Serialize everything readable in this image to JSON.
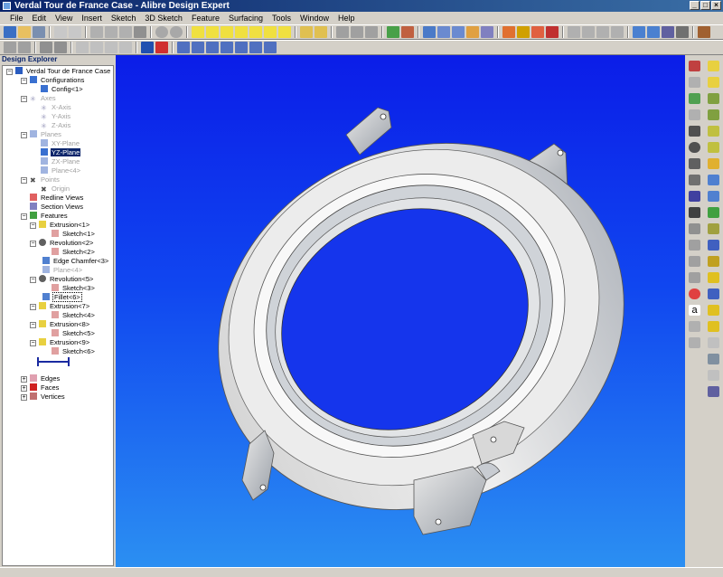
{
  "window": {
    "title": "Verdal Tour de France Case - Alibre Design Expert"
  },
  "menu": [
    "File",
    "Edit",
    "View",
    "Insert",
    "Sketch",
    "3D Sketch",
    "Feature",
    "Surfacing",
    "Tools",
    "Window",
    "Help"
  ],
  "explorer": {
    "title": "Design Explorer",
    "root": "Verdal Tour de France Case",
    "configurations": {
      "label": "Configurations",
      "child": "Config<1>"
    },
    "axes": {
      "label": "Axes",
      "children": [
        "X-Axis",
        "Y-Axis",
        "Z-Axis"
      ]
    },
    "planes": {
      "label": "Planes",
      "children": [
        "XY-Plane",
        "YZ-Plane",
        "ZX-Plane",
        "Plane<4>"
      ]
    },
    "points": {
      "label": "Points",
      "child": "Origin"
    },
    "redline_views": "Redline Views",
    "section_views": "Section Views",
    "features": {
      "label": "Features",
      "items": [
        {
          "label": "Extrusion<1>",
          "child": "Sketch<1>"
        },
        {
          "label": "Revolution<2>",
          "child": "Sketch<2>"
        },
        {
          "label": "Edge Chamfer<3>"
        },
        {
          "label": "Plane<4>"
        },
        {
          "label": "Revolution<5>",
          "child": "Sketch<3>"
        },
        {
          "label": "Fillet<6>"
        },
        {
          "label": "Extrusion<7>",
          "child": "Sketch<4>"
        },
        {
          "label": "Extrusion<8>",
          "child": "Sketch<5>"
        },
        {
          "label": "Extrusion<9>",
          "child": "Sketch<6>"
        }
      ]
    },
    "edges": "Edges",
    "faces": "Faces",
    "vertices": "Vertices"
  },
  "colors": {
    "viewport_top": "#0b1de8",
    "viewport_bottom": "#2b8ff2",
    "selection": "#0a246a",
    "model_face": "#dcdcdc"
  }
}
